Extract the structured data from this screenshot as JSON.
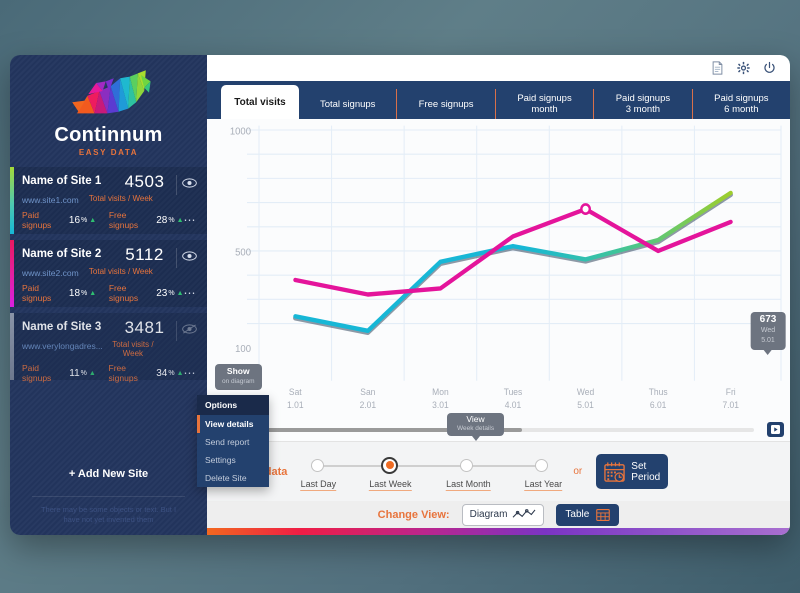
{
  "brand": {
    "name": "Continnum",
    "tagline": "EASY DATA",
    "logo_icon": "rhino-logo-icon"
  },
  "topbar": {
    "icons": [
      {
        "name": "document-icon",
        "glyph": "doc"
      },
      {
        "name": "gear-icon",
        "glyph": "gear"
      },
      {
        "name": "power-icon",
        "glyph": "power"
      }
    ]
  },
  "tabs": [
    {
      "label": "Total visits",
      "active": true
    },
    {
      "label": "Total signups",
      "active": false
    },
    {
      "label": "Free signups",
      "active": false
    },
    {
      "label": "Paid signups\nmonth",
      "line1": "Paid signups",
      "line2": "month",
      "active": false
    },
    {
      "label": "Paid signups\n3 month",
      "line1": "Paid signups",
      "line2": "3 month",
      "active": false
    },
    {
      "label": "Paid signups\n6 month",
      "line1": "Paid signups",
      "line2": "6 month",
      "active": false
    }
  ],
  "sidebar": {
    "sites": [
      {
        "name": "Name of Site 1",
        "visits": "4503",
        "visits_caption": "Total visits / Week",
        "url": "www.site1.com",
        "paid_label": "Paid signups",
        "paid_value": "16",
        "paid_unit": "%",
        "free_label": "Free signups",
        "free_value": "28",
        "free_unit": "%",
        "more_icon": "ellipsis-icon",
        "eye_icon": "eye-visible-icon",
        "accent": "#4ec9b0",
        "visible": true
      },
      {
        "name": "Name of Site 2",
        "visits": "5112",
        "visits_caption": "Total visits / Week",
        "url": "www.site2.com",
        "paid_label": "Paid signups",
        "paid_value": "18",
        "paid_unit": "%",
        "free_label": "Free signups",
        "free_value": "23",
        "free_unit": "%",
        "more_icon": "ellipsis-icon",
        "eye_icon": "eye-visible-icon",
        "accent": "#e41fa0",
        "visible": true
      },
      {
        "name": "Name of Site 3",
        "visits": "3481",
        "visits_caption": "Total visits / Week",
        "url": "www.verylongadres...",
        "paid_label": "Paid signups",
        "paid_value": "11",
        "paid_unit": "%",
        "free_label": "Free signups",
        "free_value": "34",
        "free_unit": "%",
        "more_icon": "ellipsis-icon",
        "eye_icon": "eye-hidden-icon",
        "accent": "#8a93a6",
        "visible": false
      }
    ],
    "add_site": "+ Add New Site",
    "footer_note": "There may be some objects or text. But I have not yet invented them"
  },
  "options_menu": {
    "title": "Options",
    "items": [
      {
        "label": "View details",
        "highlighted": true
      },
      {
        "label": "Send report",
        "highlighted": false
      },
      {
        "label": "Settings",
        "highlighted": false
      },
      {
        "label": "Delete Site",
        "highlighted": false
      }
    ]
  },
  "tooltips": {
    "show_on_diagram": {
      "line1": "Show",
      "line2": "on diagram"
    },
    "view_week": {
      "line1": "View",
      "line2": "Week details"
    },
    "data_point": {
      "value": "673",
      "label": "Wed  5.01"
    }
  },
  "scale": {
    "label": "Scale Ddata",
    "options": [
      {
        "label": "Last Day",
        "selected": false
      },
      {
        "label": "Last Week",
        "selected": true
      },
      {
        "label": "Last Month",
        "selected": false
      },
      {
        "label": "Last Year",
        "selected": false
      }
    ],
    "or": "or",
    "set_period_line1": "Set",
    "set_period_line2": "Period",
    "calendar_icon": "calendar-clock-icon"
  },
  "change_view": {
    "label": "Change View:",
    "diagram_label": "Diagram",
    "diagram_icon": "line-chart-icon",
    "table_label": "Table",
    "table_icon": "table-grid-icon"
  },
  "scrub": {
    "play_icon": "play-icon"
  },
  "chart_data": {
    "type": "line",
    "title": "Total visits",
    "xlabel": "",
    "ylabel": "",
    "grid": true,
    "legend": "none",
    "ylim": [
      100,
      1000
    ],
    "ytick_labels": [
      "1000",
      "500",
      "100"
    ],
    "yticks": [
      1000,
      500,
      100
    ],
    "categories": [
      "Sat",
      "San",
      "Mon",
      "Tues",
      "Wed",
      "Thus",
      "Fri"
    ],
    "xtick_dates": [
      "1.01",
      "2.01",
      "3.01",
      "4.01",
      "5.01",
      "6.01",
      "7.01"
    ],
    "series": [
      {
        "name": "Name of Site 1",
        "color": "#17b7d6",
        "color2": "#9ece2d",
        "values": [
          230,
          170,
          455,
          520,
          465,
          545,
          740
        ]
      },
      {
        "name": "Name of Site 2",
        "color": "#e4149b",
        "values": [
          380,
          320,
          345,
          560,
          673,
          500,
          620
        ]
      }
    ],
    "annotation": {
      "series": "Name of Site 2",
      "x": "Wed 5.01",
      "value": 673
    }
  }
}
